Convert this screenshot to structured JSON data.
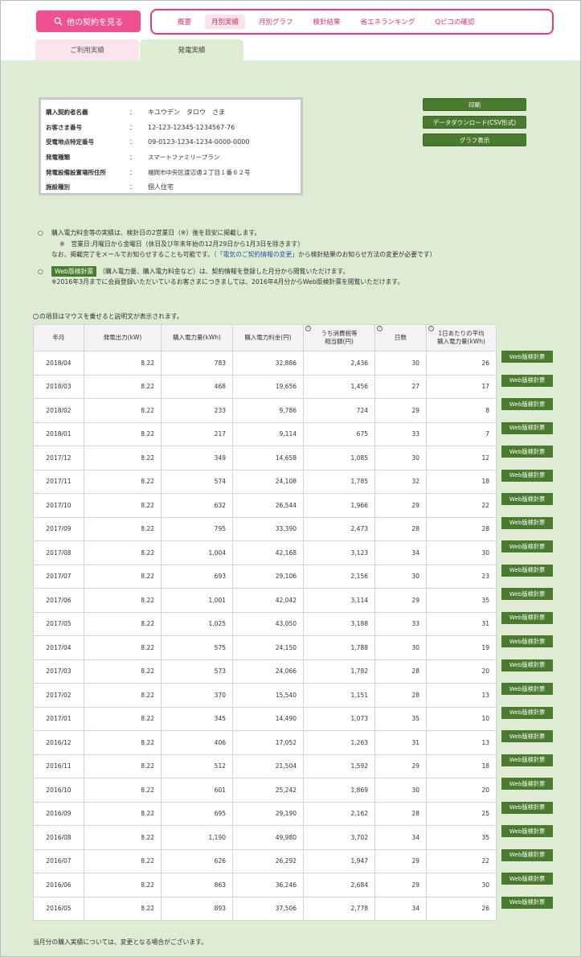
{
  "header": {
    "other_contracts": "他の契約を見る",
    "nav": [
      "概要",
      "月別実績",
      "月別グラフ",
      "検針結果",
      "省エネランキング",
      "Qピコの確認"
    ]
  },
  "tabs": {
    "usage": "ご利用実績",
    "generation": "発電実績"
  },
  "info": [
    {
      "label": "購入契約者名義",
      "value": "キユウデン　タロウ　さま"
    },
    {
      "label": "お客さま番号",
      "value": "12-123-12345-1234567-76"
    },
    {
      "label": "受電地点特定番号",
      "value": "09-0123-1234-1234-0000-0000"
    },
    {
      "label": "発電種類",
      "value": "スマートファミリープラン"
    },
    {
      "label": "発電設備設置場所住所",
      "value": "福岡市中央区渡辺通２丁目１番８２号"
    },
    {
      "label": "施設種別",
      "value": "個人住宅"
    }
  ],
  "colon": "：",
  "buttons": {
    "print": "印刷",
    "csv": "データダウンロード(CSV形式)",
    "graph": "グラフ表示"
  },
  "notes": {
    "bullet": "○",
    "line1": "購入電力料金等の実績は、検針日の2営業日（※）後を目安に掲載します。",
    "line2": "※　営業日:月曜日から金曜日（休日及び年末年始の12月29日から1月3日を除きます）",
    "line3a": "なお、掲載完了をメールでお知らせすることも可能です。（",
    "line3link": "「電気のご契約情報の変更」",
    "line3b": "から検針結果のお知らせ方法の変更が必要です）",
    "web_badge": "Web版検針票",
    "line4": "（購入電力量、購入電力料金など）は、契約情報を登録した月分から閲覧いただけます。",
    "line5": "※2016年3月までに会員登録いただいているお客さまにつきましては、2016年4月分からWeb版検針票を閲覧いただけます。"
  },
  "table_hint": "の項目はマウスを乗せると説明文が表示されます。",
  "help_glyph": "?",
  "table": {
    "headers": [
      "年月",
      "発電出力(kW)",
      "購入電力量(kWh)",
      "購入電力料金(円)",
      "うち消費税等\n相当額(円)",
      "日数",
      "1日あたりの平均\n購入電力量(kWh)"
    ],
    "rows": [
      [
        "2018/04",
        "8.22",
        "783",
        "32,886",
        "2,436",
        "30",
        "26"
      ],
      [
        "2018/03",
        "8.22",
        "468",
        "19,656",
        "1,456",
        "27",
        "17"
      ],
      [
        "2018/02",
        "8.22",
        "233",
        "9,786",
        "724",
        "29",
        "8"
      ],
      [
        "2018/01",
        "8.22",
        "217",
        "9,114",
        "675",
        "33",
        "7"
      ],
      [
        "2017/12",
        "8.22",
        "349",
        "14,658",
        "1,085",
        "30",
        "12"
      ],
      [
        "2017/11",
        "8.22",
        "574",
        "24,108",
        "1,785",
        "32",
        "18"
      ],
      [
        "2017/10",
        "8.22",
        "632",
        "26,544",
        "1,966",
        "29",
        "22"
      ],
      [
        "2017/09",
        "8.22",
        "795",
        "33,390",
        "2,473",
        "28",
        "28"
      ],
      [
        "2017/08",
        "8.22",
        "1,004",
        "42,168",
        "3,123",
        "34",
        "30"
      ],
      [
        "2017/07",
        "8.22",
        "693",
        "29,106",
        "2,156",
        "30",
        "23"
      ],
      [
        "2017/06",
        "8.22",
        "1,001",
        "42,042",
        "3,114",
        "29",
        "35"
      ],
      [
        "2017/05",
        "8.22",
        "1,025",
        "43,050",
        "3,188",
        "33",
        "31"
      ],
      [
        "2017/04",
        "8.22",
        "575",
        "24,150",
        "1,788",
        "30",
        "19"
      ],
      [
        "2017/03",
        "8.22",
        "573",
        "24,066",
        "1,782",
        "28",
        "20"
      ],
      [
        "2017/02",
        "8.22",
        "370",
        "15,540",
        "1,151",
        "28",
        "13"
      ],
      [
        "2017/01",
        "8.22",
        "345",
        "14,490",
        "1,073",
        "35",
        "10"
      ],
      [
        "2016/12",
        "8.22",
        "406",
        "17,052",
        "1,263",
        "31",
        "13"
      ],
      [
        "2016/11",
        "8.22",
        "512",
        "21,504",
        "1,592",
        "29",
        "18"
      ],
      [
        "2016/10",
        "8.22",
        "601",
        "25,242",
        "1,869",
        "30",
        "20"
      ],
      [
        "2016/09",
        "8.22",
        "695",
        "29,190",
        "2,162",
        "28",
        "25"
      ],
      [
        "2016/08",
        "8.22",
        "1,190",
        "49,980",
        "3,702",
        "34",
        "35"
      ],
      [
        "2016/07",
        "8.22",
        "626",
        "26,292",
        "1,947",
        "29",
        "22"
      ],
      [
        "2016/06",
        "8.22",
        "863",
        "36,246",
        "2,684",
        "29",
        "30"
      ],
      [
        "2016/05",
        "8.22",
        "893",
        "37,506",
        "2,778",
        "34",
        "26"
      ]
    ],
    "row_button": "Web版検針票"
  },
  "footer_note": "当月分の購入実績については、変更となる場合がございます。"
}
